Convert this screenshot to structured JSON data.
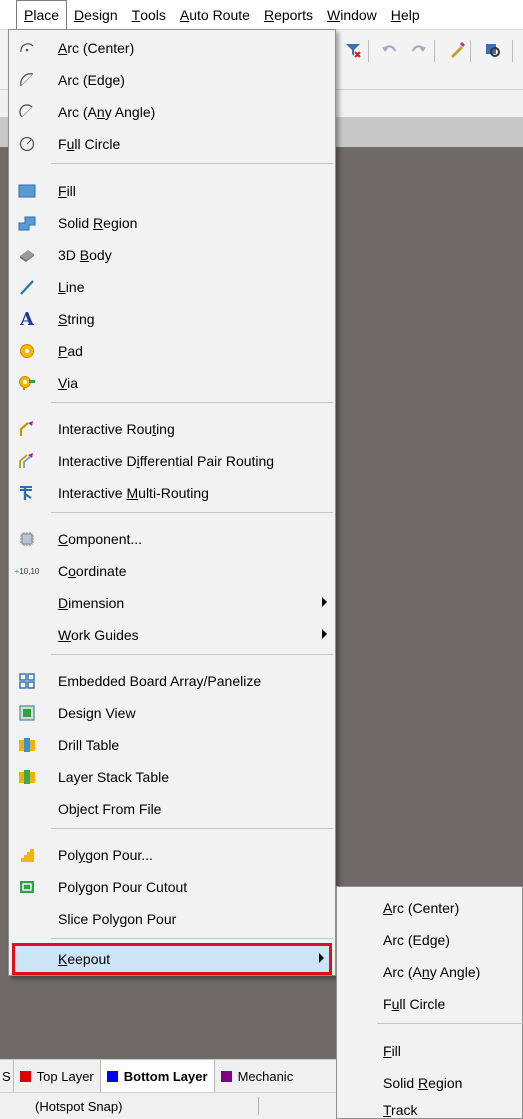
{
  "menubar": {
    "items": [
      {
        "pre": "",
        "ul": "P",
        "post": "lace"
      },
      {
        "pre": "",
        "ul": "D",
        "post": "esign"
      },
      {
        "pre": "",
        "ul": "T",
        "post": "ools"
      },
      {
        "pre": "",
        "ul": "A",
        "post": "uto Route"
      },
      {
        "pre": "",
        "ul": "R",
        "post": "eports"
      },
      {
        "pre": "",
        "ul": "W",
        "post": "indow"
      },
      {
        "pre": "",
        "ul": "H",
        "post": "elp"
      }
    ]
  },
  "toolbar": {
    "icons": [
      "filter-clear-icon",
      "undo-icon",
      "redo-icon",
      "highlight-icon",
      "zoom-icon"
    ]
  },
  "place_menu": {
    "items": [
      {
        "pre": "",
        "ul": "A",
        "post": "rc (Center)",
        "icon": "arc-center-icon"
      },
      {
        "pre": "Arc (Ed",
        "ul": "g",
        "post": "e)",
        "icon": "arc-edge-icon"
      },
      {
        "pre": "Arc (A",
        "ul": "n",
        "post": "y Angle)",
        "icon": "arc-any-angle-icon"
      },
      {
        "pre": "F",
        "ul": "u",
        "post": "ll Circle",
        "icon": "full-circle-icon"
      },
      {
        "pre": "",
        "ul": "F",
        "post": "ill",
        "icon": "fill-icon"
      },
      {
        "pre": "Solid ",
        "ul": "R",
        "post": "egion",
        "icon": "solid-region-icon"
      },
      {
        "pre": "3D ",
        "ul": "B",
        "post": "ody",
        "icon": "3d-body-icon"
      },
      {
        "pre": "",
        "ul": "L",
        "post": "ine",
        "icon": "line-icon"
      },
      {
        "pre": "",
        "ul": "S",
        "post": "tring",
        "icon": "string-icon"
      },
      {
        "pre": "",
        "ul": "P",
        "post": "ad",
        "icon": "pad-icon"
      },
      {
        "pre": "",
        "ul": "V",
        "post": "ia",
        "icon": "via-icon"
      },
      {
        "pre": "Interactive Rou",
        "ul": "t",
        "post": "ing",
        "icon": "interactive-routing-icon"
      },
      {
        "pre": "Interactive D",
        "ul": "i",
        "post": "fferential Pair Routing",
        "icon": "differential-pair-routing-icon"
      },
      {
        "pre": "Interactive ",
        "ul": "M",
        "post": "ulti-Routing",
        "icon": "multi-routing-icon"
      },
      {
        "pre": "",
        "ul": "C",
        "post": "omponent...",
        "icon": "component-icon"
      },
      {
        "pre": "C",
        "ul": "o",
        "post": "ordinate",
        "icon": "coordinate-icon"
      },
      {
        "pre": "",
        "ul": "D",
        "post": "imension",
        "icon": "",
        "submenu": true
      },
      {
        "pre": "",
        "ul": "W",
        "post": "ork Guides",
        "icon": "",
        "submenu": true
      },
      {
        "pre": "Embedded Board Array/Panelize",
        "ul": "",
        "post": "",
        "icon": "board-array-icon"
      },
      {
        "pre": "Design View",
        "ul": "",
        "post": "",
        "icon": "design-view-icon"
      },
      {
        "pre": "Drill Table",
        "ul": "",
        "post": "",
        "icon": "drill-table-icon"
      },
      {
        "pre": "Layer Stack Table",
        "ul": "",
        "post": "",
        "icon": "layer-stack-table-icon"
      },
      {
        "pre": "Object From File",
        "ul": "",
        "post": "",
        "icon": ""
      },
      {
        "pre": "Pol",
        "ul": "y",
        "post": "gon Pour...",
        "icon": "polygon-pour-icon"
      },
      {
        "pre": "Polygon Pour Cutout",
        "ul": "",
        "post": "",
        "icon": "polygon-pour-cutout-icon"
      },
      {
        "pre": "Slice Polygon Pour",
        "ul": "",
        "post": "",
        "icon": ""
      },
      {
        "pre": "",
        "ul": "K",
        "post": "eepout",
        "icon": "",
        "submenu": true,
        "highlighted": true
      }
    ]
  },
  "keepout_submenu": {
    "items": [
      {
        "pre": "",
        "ul": "A",
        "post": "rc (Center)"
      },
      {
        "pre": "Arc (Ed",
        "ul": "g",
        "post": "e)"
      },
      {
        "pre": "Arc (A",
        "ul": "n",
        "post": "y Angle)"
      },
      {
        "pre": "F",
        "ul": "u",
        "post": "ll Circle"
      },
      {
        "pre": "",
        "ul": "F",
        "post": "ill"
      },
      {
        "pre": "Solid ",
        "ul": "R",
        "post": "egion"
      },
      {
        "pre": "",
        "ul": "T",
        "post": "rack"
      }
    ]
  },
  "layer_tabs": {
    "partial_left": "S",
    "items": [
      {
        "label": "Top Layer",
        "color": "#e00000",
        "selected": false
      },
      {
        "label": "Bottom Layer",
        "color": "#0000ff",
        "selected": true
      },
      {
        "label": "Mechanic",
        "color": "#800080",
        "selected": false
      }
    ]
  },
  "statusbar": {
    "text": "(Hotspot Snap)"
  },
  "colors": {
    "highlight_border": "#e0101a",
    "highlight_fill": "#cce4f7",
    "workspace": "#6f6a68"
  }
}
